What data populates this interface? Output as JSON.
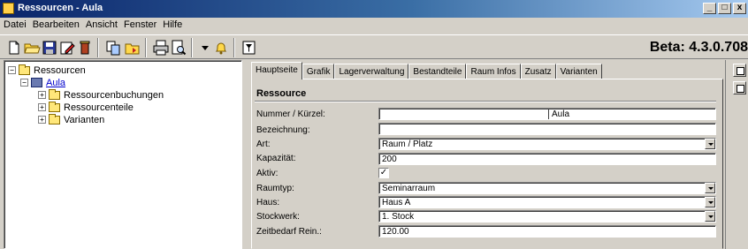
{
  "window": {
    "title": "Ressourcen - Aula",
    "min": "_",
    "max": "□",
    "close": "x"
  },
  "menu": [
    "Datei",
    "Bearbeiten",
    "Ansicht",
    "Fenster",
    "Hilfe"
  ],
  "toolbar": {
    "version": "Beta: 4.3.0.708"
  },
  "tree": {
    "root": "Ressourcen",
    "child": "Aula",
    "items": [
      "Ressourcenbuchungen",
      "Ressourcenteile",
      "Varianten"
    ],
    "expander_minus": "−",
    "expander_plus": "+"
  },
  "tabs": [
    "Hauptseite",
    "Grafik",
    "Lagerverwaltung",
    "Bestandteile",
    "Raum Infos",
    "Zusatz",
    "Varianten"
  ],
  "section": {
    "title": "Ressource"
  },
  "fields": {
    "nummer_label": "Nummer / Kürzel:",
    "nummer_value": "",
    "kuerzel_value": "Aula",
    "bezeichnung_label": "Bezeichnung:",
    "bezeichnung_value": "",
    "art_label": "Art:",
    "art_value": "Raum / Platz",
    "kapazitaet_label": "Kapazität:",
    "kapazitaet_value": "200",
    "aktiv_label": "Aktiv:",
    "aktiv_check": "✓",
    "raumtyp_label": "Raumtyp:",
    "raumtyp_value": "Seminarraum",
    "haus_label": "Haus:",
    "haus_value": "Haus A",
    "stockwerk_label": "Stockwerk:",
    "stockwerk_value": "1. Stock",
    "zeitbedarf_label": "Zeitbedarf Rein.:",
    "zeitbedarf_value": "120.00"
  }
}
